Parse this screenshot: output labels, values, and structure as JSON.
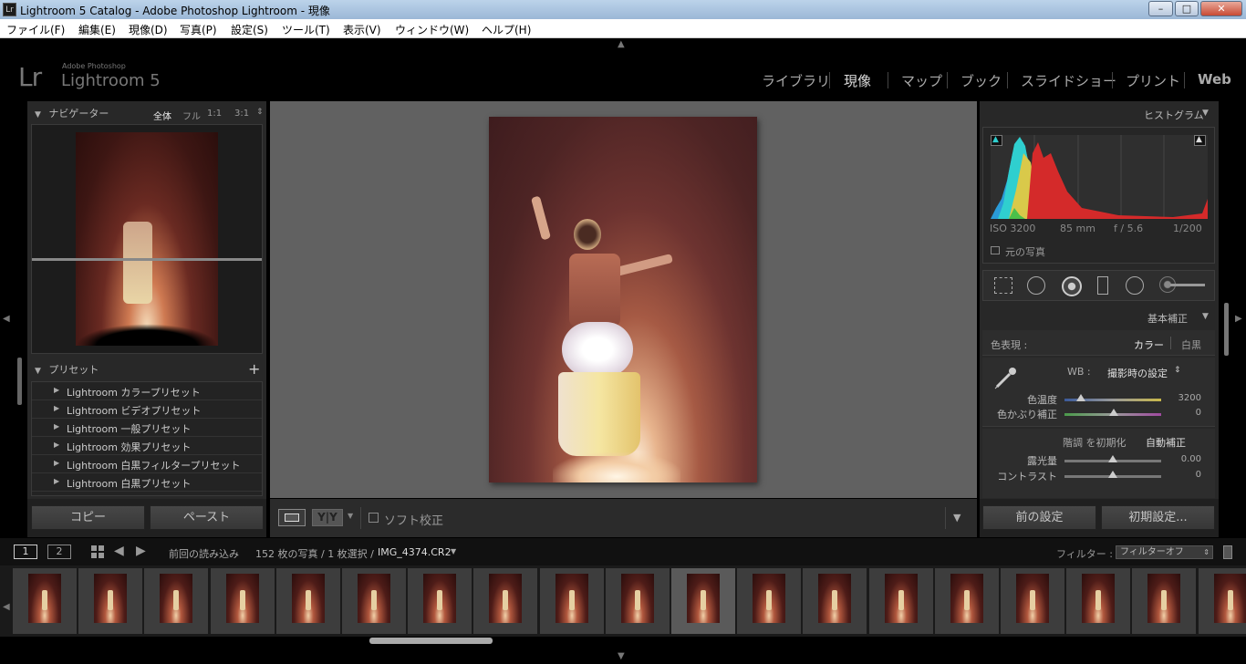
{
  "window": {
    "title": "Lightroom 5 Catalog - Adobe Photoshop Lightroom - 現像",
    "icon": "Lr",
    "minimize": "–",
    "maximize": "□",
    "close": "✕"
  },
  "menu": [
    "ファイル(F)",
    "編集(E)",
    "現像(D)",
    "写真(P)",
    "設定(S)",
    "ツール(T)",
    "表示(V)",
    "ウィンドウ(W)",
    "ヘルプ(H)"
  ],
  "logo": {
    "mark": "Lr",
    "brand": "Adobe Photoshop",
    "product": "Lightroom 5"
  },
  "modules": [
    "ライブラリ",
    "現像",
    "マップ",
    "ブック",
    "スライドショー",
    "プリント",
    "Web"
  ],
  "navigator": {
    "title": "ナビゲーター",
    "zoom": [
      "全体",
      "フル",
      "1:1",
      "3:1"
    ]
  },
  "presets": {
    "title": "プリセット",
    "add": "+",
    "items": [
      "Lightroom カラープリセット",
      "Lightroom ビデオプリセット",
      "Lightroom 一般プリセット",
      "Lightroom 効果プリセット",
      "Lightroom 白黒フィルタープリセット",
      "Lightroom 白黒プリセット"
    ]
  },
  "left_buttons": {
    "copy": "コピー",
    "paste": "ペースト"
  },
  "toolbar": {
    "soft_proof": "ソフト校正",
    "yy": "Y|Y"
  },
  "histogram": {
    "title": "ヒストグラム",
    "iso": "ISO 3200",
    "focal": "85 mm",
    "aperture": "f / 5.6",
    "shutter": "1/200",
    "original": "元の写真"
  },
  "basic": {
    "title": "基本補正",
    "treatment_label": "色表現 :",
    "color": "カラー",
    "bw": "白黒",
    "wb_label": "WB :",
    "wb_value": "撮影時の設定",
    "temp_label": "色温度",
    "temp_value": "3200",
    "tint_label": "色かぶり補正",
    "tint_value": "0",
    "tone_label": "階調 を初期化",
    "auto": "自動補正",
    "exposure_label": "露光量",
    "exposure_value": "0.00",
    "contrast_label": "コントラスト",
    "contrast_value": "0"
  },
  "right_buttons": {
    "previous": "前の設定",
    "reset": "初期設定..."
  },
  "filmstrip_bar": {
    "page1": "1",
    "page2": "2",
    "source": "前回の読み込み",
    "count": "152 枚の写真 / 1 枚選択 /",
    "filename": "IMG_4374.CR2",
    "filter_label": "フィルター :",
    "filter_value": "フィルターオフ"
  },
  "colors": {
    "accent": "#3b3b3b",
    "panel": "#2a2a2a",
    "center": "#616161"
  }
}
